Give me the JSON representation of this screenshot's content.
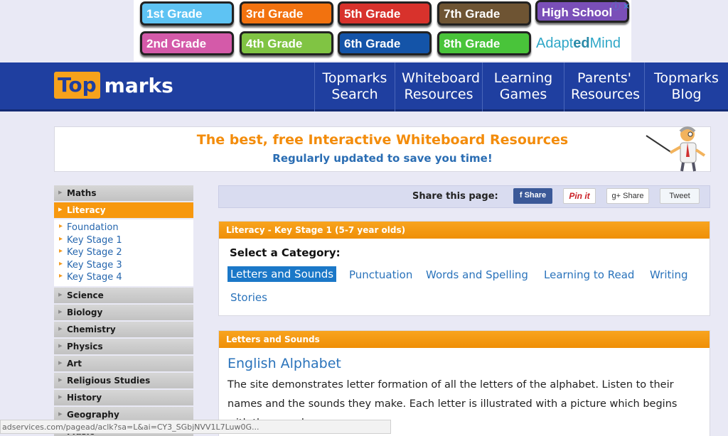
{
  "ad": {
    "buttons": [
      {
        "label": "1st Grade",
        "color": "#5ec3f3"
      },
      {
        "label": "3rd Grade",
        "color": "#f2720f"
      },
      {
        "label": "5th Grade",
        "color": "#d8322c"
      },
      {
        "label": "7th Grade",
        "color": "#6e5433"
      },
      {
        "label": "High School",
        "color": "#7a4fb8"
      },
      {
        "label": "2nd Grade",
        "color": "#d45aa9"
      },
      {
        "label": "4th Grade",
        "color": "#80c443"
      },
      {
        "label": "6th Grade",
        "color": "#1454a8"
      },
      {
        "label": "8th Grade",
        "color": "#49c43a"
      }
    ],
    "brand_prefix": "Adapt",
    "brand_mid": "ed",
    "brand_suffix": "Mind",
    "close": "ⓘ ✕"
  },
  "header": {
    "logo_top": "Top",
    "logo_marks": "marks",
    "nav": [
      {
        "line1": "Topmarks",
        "line2": "Search"
      },
      {
        "line1": "Whiteboard",
        "line2": "Resources"
      },
      {
        "line1": "Learning",
        "line2": "Games"
      },
      {
        "line1": "Parents'",
        "line2": "Resources"
      },
      {
        "line1": "Topmarks",
        "line2": "Blog"
      }
    ]
  },
  "banner": {
    "title": "The best, free Interactive Whiteboard Resources",
    "subtitle": "Regularly updated to save you time!"
  },
  "sidebar": {
    "top_items": [
      "Maths"
    ],
    "active": "Literacy",
    "sub_items": [
      "Foundation",
      "Key Stage 1",
      "Key Stage 2",
      "Key Stage 3",
      "Key Stage 4"
    ],
    "items": [
      "Science",
      "Biology",
      "Chemistry",
      "Physics",
      "Art",
      "Religious Studies",
      "History",
      "Geography",
      "Music"
    ]
  },
  "share": {
    "label": "Share this page:",
    "facebook": "f  Share",
    "pinterest": "Pin it",
    "google": "g+  Share",
    "twitter": "Tweet"
  },
  "category_panel": {
    "header": "Literacy - Key Stage 1 (5-7 year olds)",
    "title": "Select a Category:",
    "categories": [
      "Letters and Sounds",
      "Punctuation",
      "Words and Spelling",
      "Learning to Read",
      "Writing",
      "Stories"
    ]
  },
  "resource_panel": {
    "header": "Letters and Sounds",
    "title": "English Alphabet",
    "description": "The site demonstrates letter formation of all the letters of the alphabet. Listen to their names and the sounds they make. Each letter is illustrated with a picture which begins with the sound."
  },
  "status_bar": "adservices.com/pagead/aclk?sa=L&ai=CY3_SGbjNVV1L7Luw0G..."
}
